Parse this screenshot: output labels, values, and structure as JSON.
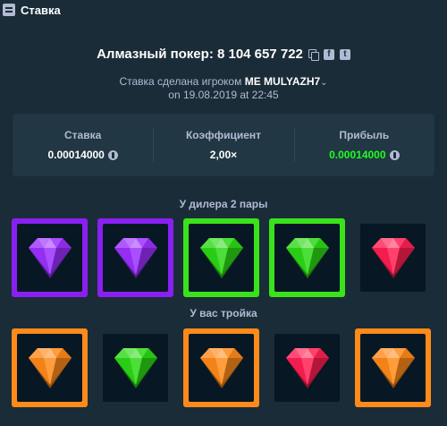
{
  "window": {
    "title": "Ставка"
  },
  "game": {
    "label": "Алмазный покер: 8 104 657 722"
  },
  "bet": {
    "placed_by_prefix": "Ставка сделана игроком ",
    "player": "ME MULYAZH7",
    "chevron": "⌄",
    "placed_on": "on 19.08.2019 at 22:45"
  },
  "stats": {
    "bet_label": "Ставка",
    "bet_value": "0.00014000",
    "multiplier_label": "Коэффициент",
    "multiplier_value": "2,00×",
    "profit_label": "Прибыль",
    "profit_value": "0.00014000"
  },
  "dealer": {
    "title": "У дилера 2 пары",
    "cards": [
      {
        "gem": "purple-gem-icon",
        "color": "#9b30ff",
        "highlight": "#8a1ff2"
      },
      {
        "gem": "purple-gem-icon",
        "color": "#9b30ff",
        "highlight": "#8a1ff2"
      },
      {
        "gem": "green-gem-icon",
        "color": "#2cd816",
        "highlight": "#3ae21b"
      },
      {
        "gem": "green-gem-icon",
        "color": "#2cd816",
        "highlight": "#3ae21b"
      },
      {
        "gem": "red-gem-icon",
        "color": "#ff1f52",
        "highlight": ""
      }
    ]
  },
  "player": {
    "title": "У вас тройка",
    "cards": [
      {
        "gem": "orange-gem-icon",
        "color": "#ff8a1a",
        "highlight": "#ff8a1a"
      },
      {
        "gem": "green-gem-icon",
        "color": "#2cd816",
        "highlight": ""
      },
      {
        "gem": "orange-gem-icon",
        "color": "#ff8a1a",
        "highlight": "#ff8a1a"
      },
      {
        "gem": "red-gem-icon",
        "color": "#ff1f52",
        "highlight": ""
      },
      {
        "gem": "orange-gem-icon",
        "color": "#ff8a1a",
        "highlight": "#ff8a1a"
      }
    ]
  }
}
